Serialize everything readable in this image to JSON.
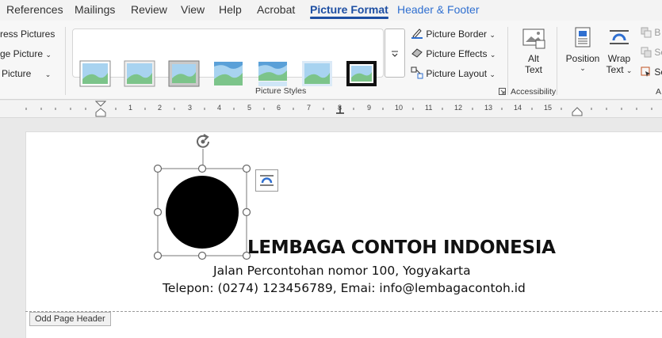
{
  "tabs": [
    "References",
    "Mailings",
    "Review",
    "View",
    "Help",
    "Acrobat",
    "Picture Format",
    "Header & Footer"
  ],
  "adjust": {
    "compress": "ress Pictures",
    "change": "ge Picture",
    "reset": "Picture"
  },
  "picture_styles": {
    "group_label": "Picture Styles",
    "border": "Picture Border",
    "effects": "Picture Effects",
    "layout": "Picture Layout"
  },
  "accessibility": {
    "alt_text_1": "Alt",
    "alt_text_2": "Text",
    "group_label": "Accessibility"
  },
  "arrange": {
    "position": "Position",
    "wrap_1": "Wrap",
    "wrap_2": "Text",
    "b": "B",
    "se1": "Se",
    "se2": "Se",
    "a": "A"
  },
  "ruler": [
    "1",
    "2",
    "3",
    "4",
    "5",
    "6",
    "7",
    "8",
    "9",
    "10",
    "11",
    "12",
    "13",
    "14",
    "15"
  ],
  "document": {
    "org_name": "LEMBAGA CONTOH INDONESIA",
    "address": "Jalan Percontohan nomor 100, Yogyakarta",
    "contact": "Telepon: (0274) 123456789, Emai: info@lembagacontoh.id",
    "header_tag": "Odd Page Header"
  },
  "colors": {
    "accent": "#1e4fa3",
    "logo": "#000000"
  }
}
